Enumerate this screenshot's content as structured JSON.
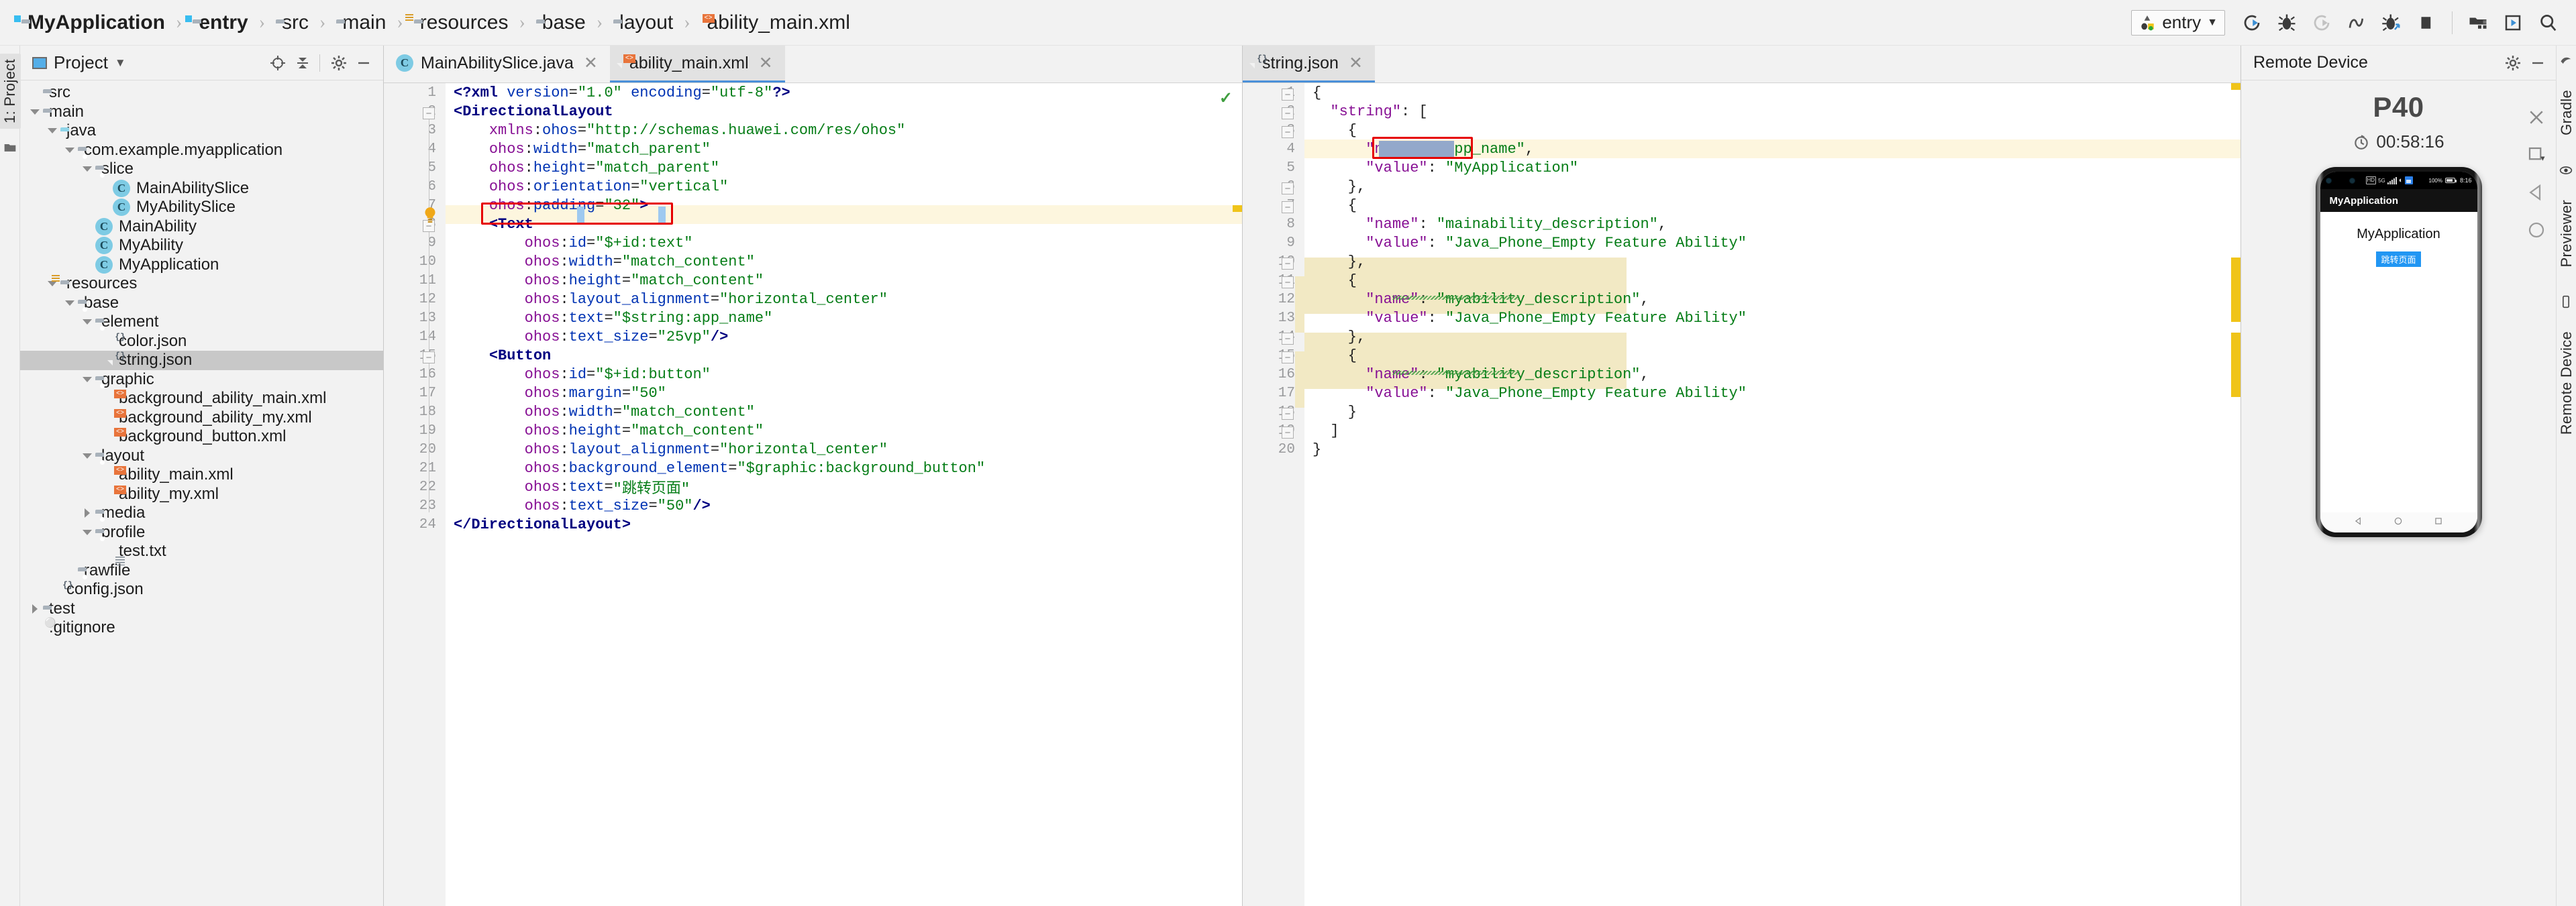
{
  "breadcrumb": [
    {
      "label": "MyApplication",
      "icon": "module-folder-icon",
      "bold": true
    },
    {
      "label": "entry",
      "icon": "module-folder-icon",
      "bold": true
    },
    {
      "label": "src",
      "icon": "folder-icon",
      "bold": false
    },
    {
      "label": "main",
      "icon": "folder-icon",
      "bold": false
    },
    {
      "label": "resources",
      "icon": "resources-folder-icon",
      "bold": false
    },
    {
      "label": "base",
      "icon": "folder-icon",
      "bold": false
    },
    {
      "label": "layout",
      "icon": "folder-icon",
      "bold": false
    },
    {
      "label": "ability_main.xml",
      "icon": "xml-file-icon",
      "bold": false
    }
  ],
  "toolbar": {
    "run_config": "entry",
    "buttons": [
      {
        "name": "run-button",
        "icon": "run-icon"
      },
      {
        "name": "debug-button",
        "icon": "debug-icon"
      },
      {
        "name": "run-with-coverage-button",
        "icon": "coverage-icon"
      },
      {
        "name": "profiler-button",
        "icon": "profiler-icon"
      },
      {
        "name": "attach-debugger-button",
        "icon": "attach-debug-icon"
      },
      {
        "name": "stop-button",
        "icon": "stop-icon"
      },
      {
        "name": "project-structure-button",
        "icon": "project-structure-icon"
      },
      {
        "name": "device-manager-button",
        "icon": "device-manager-icon"
      },
      {
        "name": "search-everywhere-button",
        "icon": "search-icon"
      }
    ]
  },
  "left_strip": {
    "project_tab": "1: Project",
    "structure_icon": "structure-icon"
  },
  "project_panel": {
    "title": "Project",
    "header_icons": [
      "locate-icon",
      "collapse-all-icon",
      "settings-icon",
      "hide-icon"
    ],
    "tree": [
      {
        "label": "src",
        "indent": 0,
        "arrow": "none",
        "icon": "folder-icon",
        "selected": false
      },
      {
        "label": "main",
        "indent": 0,
        "arrow": "down",
        "icon": "folder-icon",
        "selected": false
      },
      {
        "label": "java",
        "indent": 1,
        "arrow": "down",
        "icon": "java-folder-icon",
        "selected": false
      },
      {
        "label": "com.example.myapplication",
        "indent": 2,
        "arrow": "down",
        "icon": "package-icon",
        "selected": false
      },
      {
        "label": "slice",
        "indent": 3,
        "arrow": "down",
        "icon": "package-icon",
        "selected": false
      },
      {
        "label": "MainAbilitySlice",
        "indent": 4,
        "arrow": "none",
        "icon": "class-icon",
        "selected": false
      },
      {
        "label": "MyAbilitySlice",
        "indent": 4,
        "arrow": "none",
        "icon": "class-icon",
        "selected": false
      },
      {
        "label": "MainAbility",
        "indent": 3,
        "arrow": "none",
        "icon": "class-icon",
        "selected": false
      },
      {
        "label": "MyAbility",
        "indent": 3,
        "arrow": "none",
        "icon": "class-icon",
        "selected": false
      },
      {
        "label": "MyApplication",
        "indent": 3,
        "arrow": "none",
        "icon": "class-icon",
        "selected": false
      },
      {
        "label": "resources",
        "indent": 1,
        "arrow": "down",
        "icon": "resources-folder-icon",
        "selected": false
      },
      {
        "label": "base",
        "indent": 2,
        "arrow": "down",
        "icon": "package-icon",
        "selected": false
      },
      {
        "label": "element",
        "indent": 3,
        "arrow": "down",
        "icon": "package-icon",
        "selected": false
      },
      {
        "label": "color.json",
        "indent": 4,
        "arrow": "none",
        "icon": "json-file-icon",
        "selected": false
      },
      {
        "label": "string.json",
        "indent": 4,
        "arrow": "none",
        "icon": "json-file-icon",
        "selected": true
      },
      {
        "label": "graphic",
        "indent": 3,
        "arrow": "down",
        "icon": "package-icon",
        "selected": false
      },
      {
        "label": "background_ability_main.xml",
        "indent": 4,
        "arrow": "none",
        "icon": "xml-file-icon",
        "selected": false
      },
      {
        "label": "background_ability_my.xml",
        "indent": 4,
        "arrow": "none",
        "icon": "xml-file-icon",
        "selected": false
      },
      {
        "label": "background_button.xml",
        "indent": 4,
        "arrow": "none",
        "icon": "xml-file-icon",
        "selected": false
      },
      {
        "label": "layout",
        "indent": 3,
        "arrow": "down",
        "icon": "package-icon",
        "selected": false
      },
      {
        "label": "ability_main.xml",
        "indent": 4,
        "arrow": "none",
        "icon": "xml-file-icon",
        "selected": false
      },
      {
        "label": "ability_my.xml",
        "indent": 4,
        "arrow": "none",
        "icon": "xml-file-icon",
        "selected": false
      },
      {
        "label": "media",
        "indent": 3,
        "arrow": "right",
        "icon": "package-icon",
        "selected": false
      },
      {
        "label": "profile",
        "indent": 3,
        "arrow": "down",
        "icon": "package-icon",
        "selected": false
      },
      {
        "label": "test.txt",
        "indent": 4,
        "arrow": "none",
        "icon": "text-file-icon",
        "selected": false
      },
      {
        "label": "rawfile",
        "indent": 2,
        "arrow": "none",
        "icon": "package-icon",
        "selected": false
      },
      {
        "label": "config.json",
        "indent": 1,
        "arrow": "none",
        "icon": "json-file-icon",
        "selected": false
      },
      {
        "label": "test",
        "indent": 0,
        "arrow": "right",
        "icon": "folder-icon",
        "selected": false
      },
      {
        "label": ".gitignore",
        "indent": -1,
        "arrow": "none",
        "icon": "git-file-icon",
        "selected": false
      }
    ]
  },
  "editor_left": {
    "tabs": [
      {
        "label": "MainAbilitySlice.java",
        "icon": "class-icon",
        "active": false
      },
      {
        "label": "ability_main.xml",
        "icon": "xml-file-icon",
        "active": true
      }
    ],
    "current_line": 13,
    "inspection_status": "ok",
    "lines": [
      {
        "n": 1,
        "text": "<?xml version=\"1.0\" encoding=\"utf-8\"?>"
      },
      {
        "n": 2,
        "text": "<DirectionalLayout"
      },
      {
        "n": 3,
        "text": "    xmlns:ohos=\"http://schemas.huawei.com/res/ohos\""
      },
      {
        "n": 4,
        "text": "    ohos:width=\"match_parent\""
      },
      {
        "n": 5,
        "text": "    ohos:height=\"match_parent\""
      },
      {
        "n": 6,
        "text": "    ohos:orientation=\"vertical\""
      },
      {
        "n": 7,
        "text": "    ohos:padding=\"32\">"
      },
      {
        "n": 8,
        "text": "    <Text"
      },
      {
        "n": 9,
        "text": "        ohos:id=\"$+id:text\""
      },
      {
        "n": 10,
        "text": "        ohos:width=\"match_content\""
      },
      {
        "n": 11,
        "text": "        ohos:height=\"match_content\""
      },
      {
        "n": 12,
        "text": "        ohos:layout_alignment=\"horizontal_center\""
      },
      {
        "n": 13,
        "text": "        ohos:text=\"$string:app_name\""
      },
      {
        "n": 14,
        "text": "        ohos:text_size=\"25vp\"/>"
      },
      {
        "n": 15,
        "text": "    <Button"
      },
      {
        "n": 16,
        "text": "        ohos:id=\"$+id:button\""
      },
      {
        "n": 17,
        "text": "        ohos:margin=\"50\""
      },
      {
        "n": 18,
        "text": "        ohos:width=\"match_content\""
      },
      {
        "n": 19,
        "text": "        ohos:height=\"match_content\""
      },
      {
        "n": 20,
        "text": "        ohos:layout_alignment=\"horizontal_center\""
      },
      {
        "n": 21,
        "text": "        ohos:background_element=\"$graphic:background_button\""
      },
      {
        "n": 22,
        "text": "        ohos:text=\"跳转页面\""
      },
      {
        "n": 23,
        "text": "        ohos:text_size=\"50\"/>"
      },
      {
        "n": 24,
        "text": "</DirectionalLayout>"
      }
    ]
  },
  "editor_right": {
    "tabs": [
      {
        "label": "string.json",
        "icon": "json-file-icon",
        "active": true
      }
    ],
    "current_line": 4,
    "selected_text": "app_name",
    "lines": [
      {
        "n": 1,
        "text": "{"
      },
      {
        "n": 2,
        "text": "  \"string\": ["
      },
      {
        "n": 3,
        "text": "    {"
      },
      {
        "n": 4,
        "text": "      \"name\": \"app_name\","
      },
      {
        "n": 5,
        "text": "      \"value\": \"MyApplication\""
      },
      {
        "n": 6,
        "text": "    },"
      },
      {
        "n": 7,
        "text": "    {"
      },
      {
        "n": 8,
        "text": "      \"name\": \"mainability_description\","
      },
      {
        "n": 9,
        "text": "      \"value\": \"Java_Phone_Empty Feature Ability\""
      },
      {
        "n": 10,
        "text": "    },"
      },
      {
        "n": 11,
        "text": "    {"
      },
      {
        "n": 12,
        "text": "      \"name\": \"myability_description\","
      },
      {
        "n": 13,
        "text": "      \"value\": \"Java_Phone_Empty Feature Ability\""
      },
      {
        "n": 14,
        "text": "    },"
      },
      {
        "n": 15,
        "text": "    {"
      },
      {
        "n": 16,
        "text": "      \"name\": \"myability_description\","
      },
      {
        "n": 17,
        "text": "      \"value\": \"Java_Phone_Empty Feature Ability\""
      },
      {
        "n": 18,
        "text": "    }"
      },
      {
        "n": 19,
        "text": "  ]"
      },
      {
        "n": 20,
        "text": "}"
      }
    ]
  },
  "remote_device": {
    "title": "Remote Device",
    "header_icons": [
      "settings-icon",
      "hide-icon"
    ],
    "device_name": "P40",
    "timer": "00:58:16",
    "controls": [
      "close-icon",
      "resize-icon",
      "back-icon",
      "home-icon"
    ],
    "phone": {
      "status_bar": {
        "network_type": "HD",
        "generation": "5G",
        "battery_percent": "100%",
        "time": "8:16"
      },
      "app_bar_title": "MyApplication",
      "content_text": "MyApplication",
      "button_text": "跳转页面",
      "nav": [
        "back-nav-icon",
        "home-nav-icon",
        "recents-nav-icon"
      ]
    }
  },
  "right_strip": {
    "tabs": [
      "Gradle",
      "Previewer",
      "Remote Device"
    ]
  }
}
